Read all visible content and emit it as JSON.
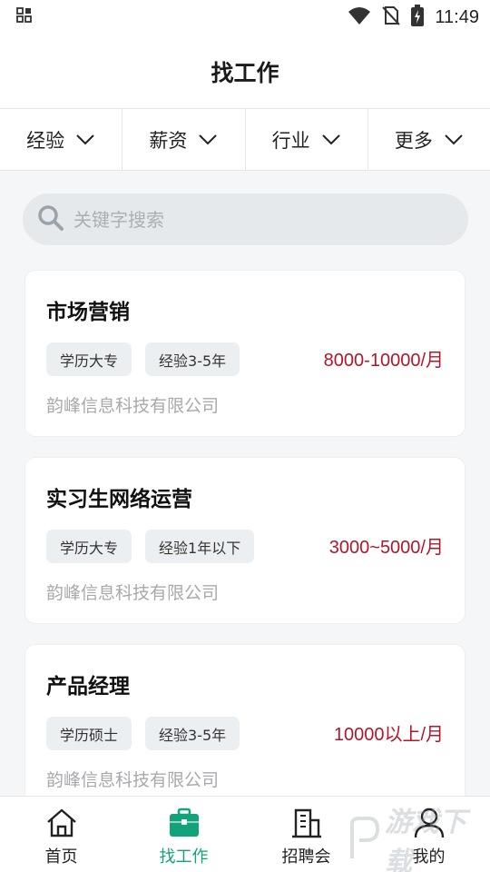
{
  "status_bar": {
    "time": "11:49",
    "icons": [
      "app-grid-icon",
      "wifi-icon",
      "no-sim-icon",
      "battery-charging-icon"
    ]
  },
  "header": {
    "title": "找工作"
  },
  "filters": [
    {
      "label": "经验",
      "icon": "chevron-down-icon"
    },
    {
      "label": "薪资",
      "icon": "chevron-down-icon"
    },
    {
      "label": "行业",
      "icon": "chevron-down-icon"
    },
    {
      "label": "更多",
      "icon": "chevron-down-icon"
    }
  ],
  "search": {
    "placeholder": "关键字搜索",
    "value": ""
  },
  "jobs": [
    {
      "title": "市场营销",
      "tags": [
        "学历大专",
        "经验3-5年"
      ],
      "salary": "8000-10000/月",
      "company": "韵峰信息科技有限公司"
    },
    {
      "title": "实习生网络运营",
      "tags": [
        "学历大专",
        "经验1年以下"
      ],
      "salary": "3000~5000/月",
      "company": "韵峰信息科技有限公司"
    },
    {
      "title": "产品经理",
      "tags": [
        "学历硕士",
        "经验3-5年"
      ],
      "salary": "10000以上/月",
      "company": "韵峰信息科技有限公司"
    }
  ],
  "bottom_nav": [
    {
      "label": "首页",
      "icon": "home-icon",
      "active": false
    },
    {
      "label": "找工作",
      "icon": "briefcase-icon",
      "active": true
    },
    {
      "label": "招聘会",
      "icon": "building-icon",
      "active": false
    },
    {
      "label": "我的",
      "icon": "user-icon",
      "active": false
    }
  ],
  "colors": {
    "accent": "#13a37a",
    "salary": "#b3162a",
    "page_bg": "#f5f6f8",
    "search_bg": "#e6e9ec"
  },
  "watermark": {
    "text": "游戏下载"
  }
}
